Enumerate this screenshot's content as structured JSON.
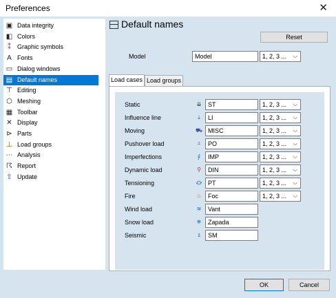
{
  "window": {
    "title": "Preferences",
    "close_glyph": "✕"
  },
  "tree": [
    {
      "label": "Data integrity",
      "icon": "data-integrity-icon",
      "glyph": "▣",
      "color": "#222"
    },
    {
      "label": "Colors",
      "icon": "colors-icon",
      "glyph": "◧",
      "color": "#222"
    },
    {
      "label": "Graphic symbols",
      "icon": "graphic-symbols-icon",
      "glyph": "⁑",
      "color": "#c0392b"
    },
    {
      "label": "Fonts",
      "icon": "fonts-icon",
      "glyph": "A",
      "color": "#222"
    },
    {
      "label": "Dialog windows",
      "icon": "dialog-windows-icon",
      "glyph": "▭",
      "color": "#222"
    },
    {
      "label": "Default names",
      "icon": "default-names-icon",
      "glyph": "▤",
      "color": "#fff",
      "selected": true
    },
    {
      "label": "Editing",
      "icon": "editing-icon",
      "glyph": "⊤",
      "color": "#222"
    },
    {
      "label": "Meshing",
      "icon": "meshing-icon",
      "glyph": "⬡",
      "color": "#222"
    },
    {
      "label": "Toolbar",
      "icon": "toolbar-icon",
      "glyph": "▦",
      "color": "#222"
    },
    {
      "label": "Display",
      "icon": "display-icon",
      "glyph": "✕",
      "color": "#222"
    },
    {
      "label": "Parts",
      "icon": "parts-icon",
      "glyph": "⊳",
      "color": "#222"
    },
    {
      "label": "Load groups",
      "icon": "load-groups-icon",
      "glyph": "⊥",
      "color": "#8a5a00"
    },
    {
      "label": "Analysis",
      "icon": "analysis-icon",
      "glyph": "⋯",
      "color": "#222"
    },
    {
      "label": "Report",
      "icon": "report-icon",
      "glyph": "☈",
      "color": "#222"
    },
    {
      "label": "Update",
      "icon": "update-icon",
      "glyph": "⇪",
      "color": "#1565c0"
    }
  ],
  "header": {
    "title": "Default names"
  },
  "reset_label": "Reset",
  "model": {
    "label": "Model",
    "value": "Model",
    "format": "1, 2, 3 ..."
  },
  "tabs": [
    {
      "label": "Load cases",
      "active": true
    },
    {
      "label": "Load groups",
      "active": false
    }
  ],
  "load_cases": [
    {
      "label": "Static",
      "icon": "static-load-icon",
      "glyph": "⇊",
      "color": "#222",
      "value": "ST",
      "format": "1, 2, 3 ..."
    },
    {
      "label": "Influence line",
      "icon": "influence-line-icon",
      "glyph": "⤓",
      "color": "#1565c0",
      "value": "LI",
      "format": "1, 2, 3 ..."
    },
    {
      "label": "Moving",
      "icon": "moving-load-icon",
      "glyph": "⛟",
      "color": "#3949ab",
      "value": "MISC",
      "format": "1, 2, 3 ..."
    },
    {
      "label": "Pushover load",
      "icon": "pushover-load-icon",
      "glyph": "⩡",
      "color": "#6a1b9a",
      "value": "PO",
      "format": "1, 2, 3 ..."
    },
    {
      "label": "Imperfections",
      "icon": "imperfections-icon",
      "glyph": "⨚",
      "color": "#1565c0",
      "value": "IMP",
      "format": "1, 2, 3 ..."
    },
    {
      "label": "Dynamic load",
      "icon": "dynamic-load-icon",
      "glyph": "⚲",
      "color": "#c62828",
      "value": "DIN",
      "format": "1, 2, 3 ..."
    },
    {
      "label": "Tensioning",
      "icon": "tensioning-icon",
      "glyph": "⛮",
      "color": "#1565c0",
      "value": "PT",
      "format": "1, 2, 3 ..."
    },
    {
      "label": "Fire",
      "icon": "fire-icon",
      "glyph": "♨",
      "color": "#e65100",
      "value": "Foc",
      "format": "1, 2, 3 ..."
    },
    {
      "label": "Wind load",
      "icon": "wind-load-icon",
      "glyph": "≋",
      "color": "#1565c0",
      "value": "Vant",
      "format": null
    },
    {
      "label": "Snow load",
      "icon": "snow-load-icon",
      "glyph": "❄",
      "color": "#1565c0",
      "value": "Zapada",
      "format": null
    },
    {
      "label": "Seismic",
      "icon": "seismic-icon",
      "glyph": "⫫",
      "color": "#1565c0",
      "value": "SM",
      "format": null
    }
  ],
  "ok_label": "OK",
  "cancel_label": "Cancel"
}
